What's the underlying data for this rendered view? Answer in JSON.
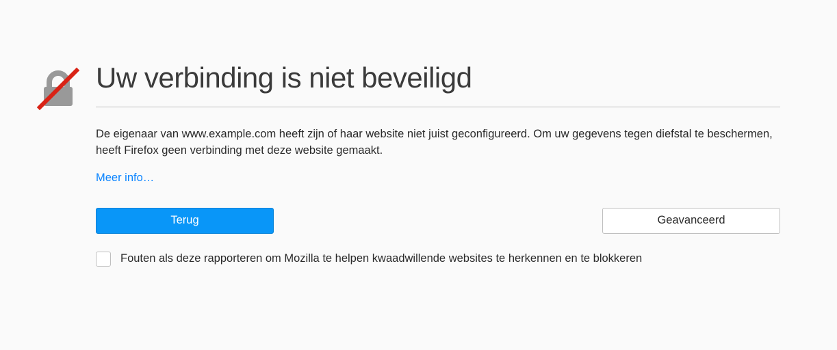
{
  "heading": "Uw verbinding is niet beveiligd",
  "description": "De eigenaar van www.example.com heeft zijn of haar website niet juist geconfigureerd. Om uw gegevens tegen diefstal te beschermen, heeft Firefox geen verbinding met deze website gemaakt.",
  "more_info_label": "Meer info…",
  "back_button_label": "Terug",
  "advanced_button_label": "Geavanceerd",
  "report_checkbox_label": "Fouten als deze rapporteren om Mozilla te helpen kwaadwillende websites te herkennen en te blokkeren",
  "colors": {
    "primary": "#0996f8",
    "link": "#0a84ff",
    "text": "#2a2a2a",
    "icon_lock": "#999999",
    "icon_slash": "#d92215"
  }
}
